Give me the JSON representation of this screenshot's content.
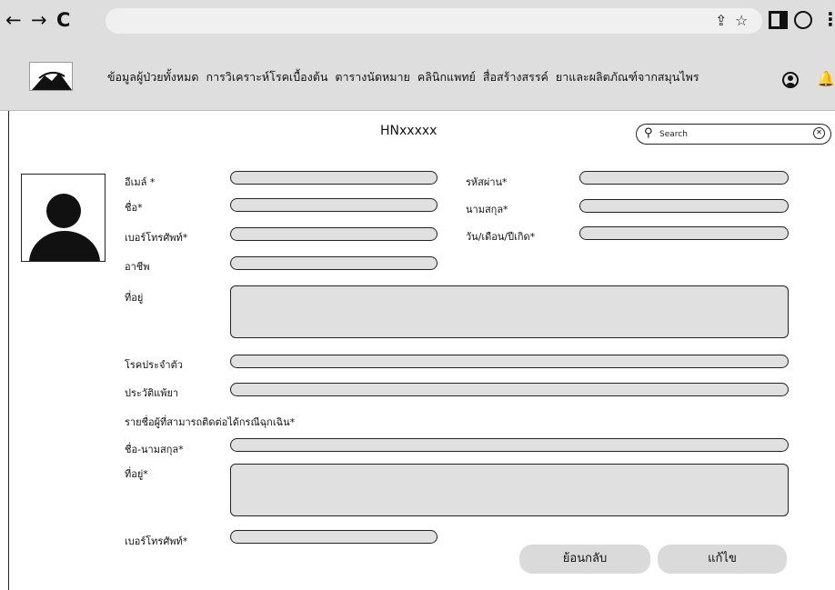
{
  "browser": {
    "back_glyph": "←",
    "forward_glyph": "→",
    "reload_glyph": "C",
    "share_glyph": "⇪",
    "star_glyph": "☆",
    "menu_glyph": "⋮"
  },
  "header": {
    "menu_items": [
      "ข้อมูลผู้ป่วยทั้งหมด",
      "การวิเคราะห์โรคเบื้องต้น",
      "ตารางนัดหมาย",
      "คลินิกแพทย์",
      "สื่อสร้างสรรค์",
      "ยาและผลิตภัณฑ์จากสมุนไพร"
    ],
    "bell_glyph": "🔔"
  },
  "page": {
    "title": "HNxxxxx"
  },
  "search": {
    "placeholder": "Search",
    "icon_glyph": "⚲",
    "clear_glyph": "✕"
  },
  "form": {
    "email_label": "อีเมล์ *",
    "password_label": "รหัสผ่าน*",
    "first_name_label": "ชื่อ*",
    "last_name_label": "นามสกุล*",
    "phone_label": "เบอร์โทรศัพท์*",
    "birthdate_label": "วัน/เดือน/ปีเกิด*",
    "occupation_label": "อาชีพ",
    "address_label": "ที่อยู่",
    "chronic_disease_label": "โรคประจำตัว",
    "drug_allergy_label": "ประวัติแพ้ยา",
    "emergency_section_label": "รายชื่อผู้ที่สามารถติดต่อได้กรณีฉุกเฉิน*",
    "emergency_name_label": "ชื่อ-นามสกุล*",
    "emergency_address_label": "ที่อยู่*",
    "emergency_phone_label": "เบอร์โทรศัพท์*"
  },
  "buttons": {
    "back_label": "ย้อนกลับ",
    "edit_label": "แก้ไข"
  },
  "colors": {
    "chrome_bg": "#dedede",
    "field_bg": "#e0e0e0",
    "button_bg": "#dadada"
  }
}
